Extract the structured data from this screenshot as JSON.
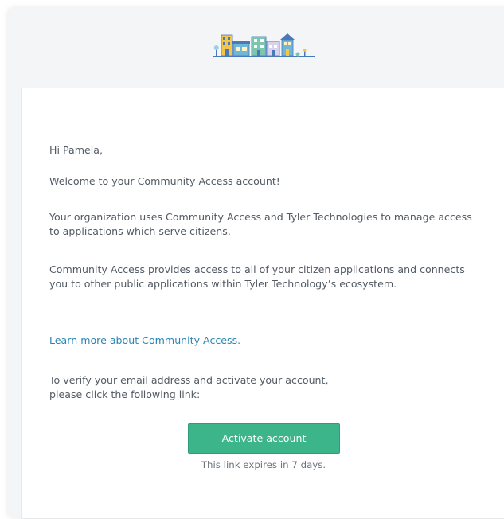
{
  "email": {
    "greeting": "Hi Pamela,",
    "welcome": "Welcome to your Community Access account!",
    "paragraph1": "Your organization uses Community Access and Tyler Technologies to manage access to applications which serve citizens.",
    "paragraph2": "Community Access provides access to all of your citizen applications and connects you to other public applications within Tyler Technology’s ecosystem.",
    "learn_more_link": "Learn more about Community Access.",
    "verify_instructions_line1": "To verify your email address and activate your account,",
    "verify_instructions_line2": "please click the following link:",
    "activate_button_label": "Activate account",
    "expires_note": "This link expires in 7 days."
  },
  "colors": {
    "frame_bg": "#f4f5f6",
    "body_text": "#525a63",
    "link": "#2a84b4",
    "button_bg": "#3cb58a",
    "button_text": "#ffffff"
  },
  "icons": {
    "logo": "community-buildings-logo-icon"
  }
}
